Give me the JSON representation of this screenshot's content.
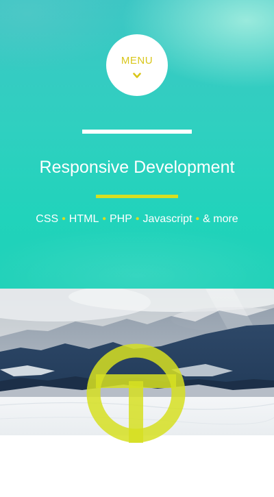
{
  "menu": {
    "label": "MENU",
    "icon": "chevron-down-icon"
  },
  "hero": {
    "title": "Responsive Development",
    "skills": [
      "CSS",
      "HTML",
      "PHP",
      "Javascript",
      "& more"
    ],
    "separator": "•"
  },
  "colors": {
    "accent_yellow": "#d6df22",
    "menu_text": "#d9c61a",
    "hero_teal": "#21d3bb",
    "white": "#ffffff"
  },
  "logo": {
    "icon": "t-logo-icon"
  }
}
